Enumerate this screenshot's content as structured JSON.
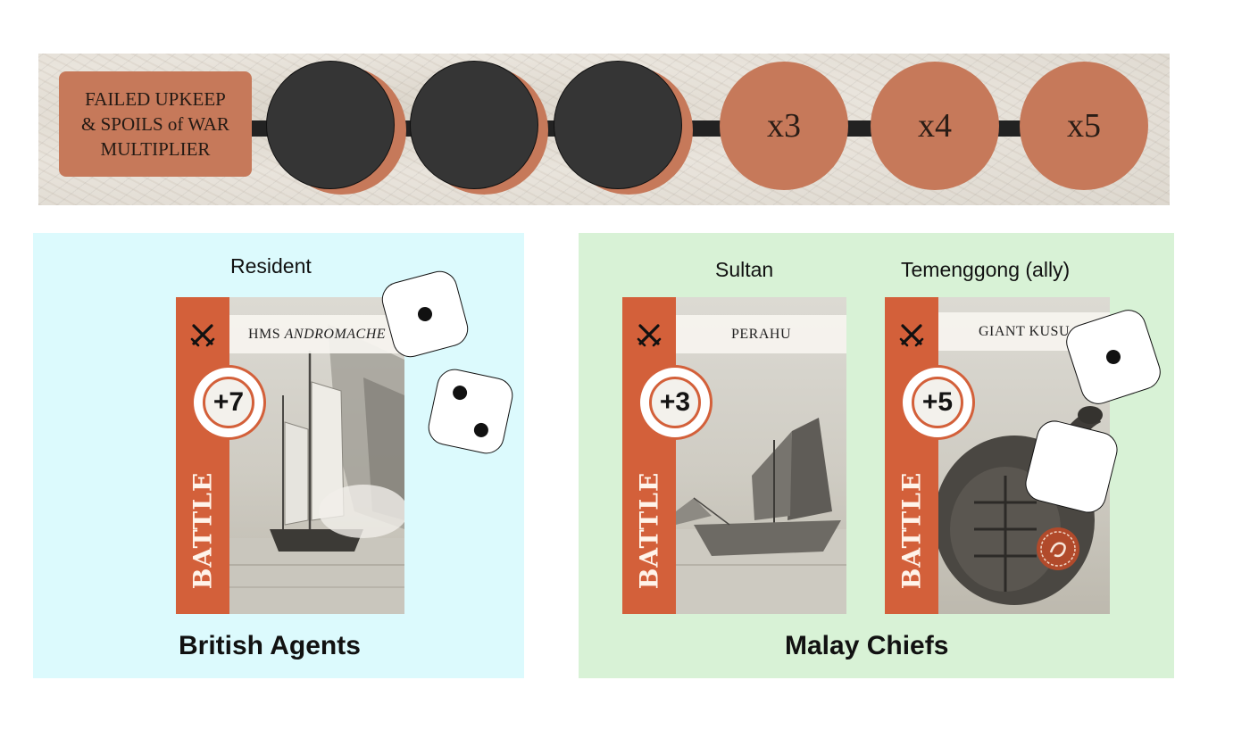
{
  "track": {
    "label": "FAILED UPKEEP\n& SPOILS of WAR\nMULTIPLIER",
    "slots": [
      {
        "label": "",
        "covered": true
      },
      {
        "label": "",
        "covered": true
      },
      {
        "label": "",
        "covered": true
      },
      {
        "label": "x3",
        "covered": false
      },
      {
        "label": "x4",
        "covered": false
      },
      {
        "label": "x5",
        "covered": false
      }
    ],
    "colors": {
      "slot": "#c6795a",
      "disc": "#353535",
      "line": "#222222"
    }
  },
  "british": {
    "title": "British Agents",
    "background": "#dcfafd",
    "resident": {
      "role": "Resident",
      "card": {
        "name_prefix": "HMS ",
        "name_italic": "ANDROMACHE",
        "modifier": "+7",
        "type": "BATTLE",
        "icon": "crossed-swords-icon"
      }
    },
    "dice": [
      1,
      2
    ]
  },
  "malay": {
    "title": "Malay Chiefs",
    "background": "#d8f2d6",
    "sultan": {
      "role": "Sultan",
      "card": {
        "name": "PERAHU",
        "modifier": "+3",
        "type": "BATTLE",
        "icon": "crossed-swords-icon"
      }
    },
    "temenggong": {
      "role": "Temenggong (ally)",
      "card": {
        "name": "GIANT KUSU",
        "modifier": "+5",
        "type": "BATTLE",
        "icon": "crossed-swords-icon"
      }
    },
    "dice": [
      1,
      0
    ]
  },
  "card_accent": "#d3603a"
}
